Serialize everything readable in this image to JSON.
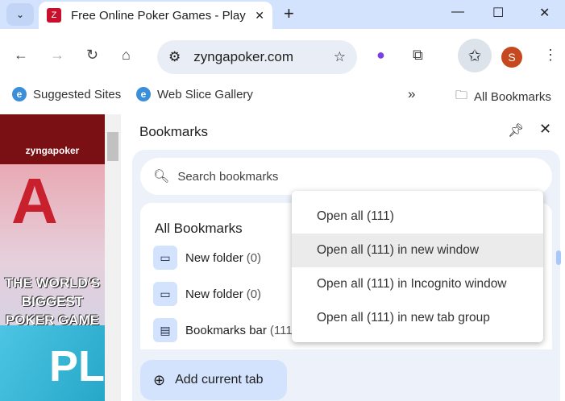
{
  "tab": {
    "title": "Free Online Poker Games - Play",
    "favicon": "Z"
  },
  "window": {
    "minimize": "—",
    "maximize": "☐",
    "close": "✕",
    "new_tab": "+",
    "tab_search": "⌄"
  },
  "toolbar": {
    "url": "zyngapoker.com",
    "profile_initial": "S"
  },
  "bookmarks_bar": {
    "items": [
      "Suggested Sites",
      "Web Slice Gallery"
    ],
    "overflow": "»",
    "all_bookmarks": "All Bookmarks"
  },
  "page": {
    "logo": "zyngapoker",
    "headline": "THE WORLD'S BIGGEST POKER GAME",
    "card": "A",
    "banner": "PL"
  },
  "panel": {
    "title": "Bookmarks",
    "search_placeholder": "Search bookmarks",
    "section": "All Bookmarks",
    "rows": [
      {
        "label": "New folder",
        "count": "(0)"
      },
      {
        "label": "New folder",
        "count": "(0)"
      },
      {
        "label": "Bookmarks bar",
        "count": "(111"
      }
    ],
    "add_current_tab": "Add current tab"
  },
  "context_menu": {
    "items": [
      "Open all (111)",
      "Open all (111) in new window",
      "Open all (111) in Incognito window",
      "Open all (111) in new tab group"
    ],
    "highlighted": 1
  }
}
